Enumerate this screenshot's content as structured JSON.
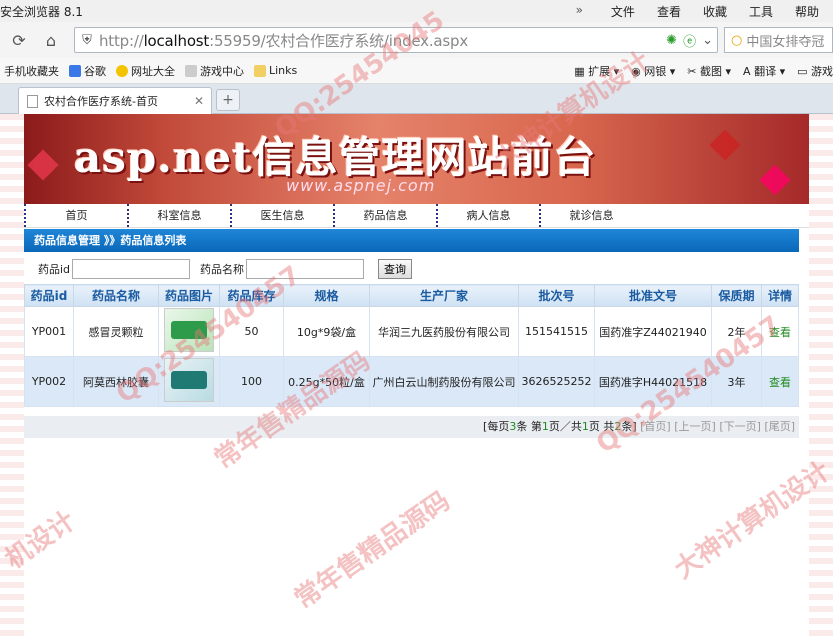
{
  "browser": {
    "title": "安全浏览器 8.1",
    "menu": [
      "文件",
      "查看",
      "收藏",
      "工具",
      "帮助"
    ],
    "url_prefix": "http://",
    "url_host": "localhost",
    "url_rest": ":55959/农村合作医疗系统/index.aspx",
    "search_placeholder": "中国女排夺冠",
    "favorites": [
      "手机收藏夹",
      "谷歌",
      "网址大全",
      "游戏中心",
      "Links"
    ],
    "tools": [
      "扩展",
      "网银",
      "截图",
      "翻译",
      "游戏"
    ],
    "tab_title": "农村合作医疗系统-首页",
    "new_tab": "+"
  },
  "banner": {
    "title": "asp.net信息管理网站前台",
    "subtitle": "www.aspnej.com"
  },
  "nav": [
    "首页",
    "科室信息",
    "医生信息",
    "药品信息",
    "病人信息",
    "就诊信息"
  ],
  "breadcrumb": "药品信息管理 》》药品信息列表",
  "search": {
    "id_label": "药品id",
    "name_label": "药品名称",
    "button": "查询"
  },
  "table": {
    "headers": [
      "药品id",
      "药品名称",
      "药品图片",
      "药品库存",
      "规格",
      "生产厂家",
      "批次号",
      "批准文号",
      "保质期",
      "详情"
    ],
    "rows": [
      {
        "id": "YP001",
        "name": "感冒灵颗粒",
        "stock": "50",
        "spec": "10g*9袋/盒",
        "maker": "华润三九医药股份有限公司",
        "batch": "151541515",
        "approval": "国药准字Z44021940",
        "shelf": "2年",
        "detail": "查看"
      },
      {
        "id": "YP002",
        "name": "阿莫西林胶囊",
        "stock": "100",
        "spec": "0.25g*50粒/盒",
        "maker": "广州白云山制药股份有限公司",
        "batch": "3626525252",
        "approval": "国药准字H44021518",
        "shelf": "3年",
        "detail": "查看"
      }
    ]
  },
  "pager": {
    "p1": "[每页",
    "per_page": "3",
    "p2": "条 第",
    "current": "1",
    "p3": "页／共",
    "total_pages": "1",
    "p4": "页 共",
    "total_rows": "2",
    "p5": "条]",
    "first": "[首页]",
    "prev": "[上一页]",
    "next": "[下一页]",
    "last": "[尾页]"
  },
  "watermarks": [
    "QQ:25454045",
    "大神计算机设计",
    "常年售精品源码",
    "QQ:254540457",
    "机设计",
    "大神计算机设计",
    "QQ:254540457",
    "常年售精品源码"
  ]
}
